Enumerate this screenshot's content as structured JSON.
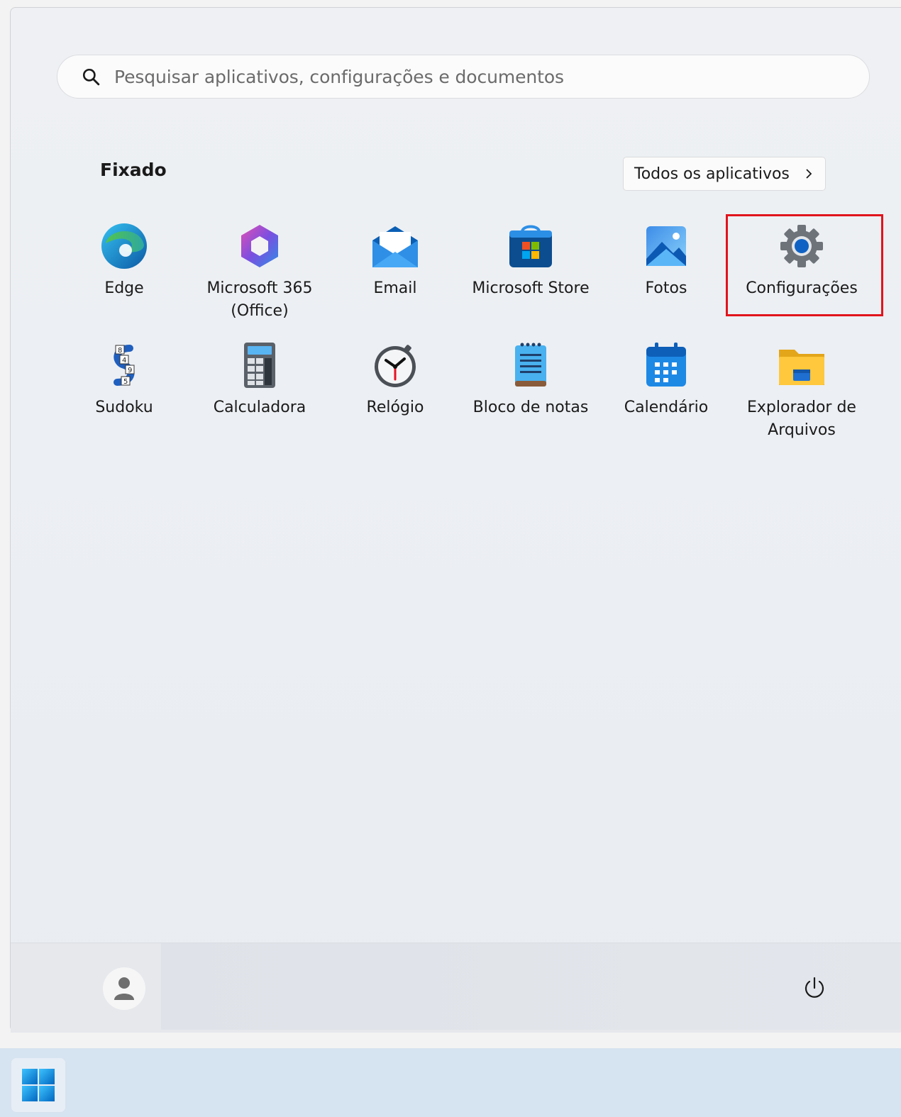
{
  "search": {
    "placeholder": "Pesquisar aplicativos, configurações e documentos",
    "icon": "search-icon"
  },
  "pinned": {
    "title": "Fixado",
    "all_apps_label": "Todos os aplicativos",
    "apps": [
      {
        "label": "Edge",
        "icon": "edge-icon"
      },
      {
        "label": "Microsoft 365\n(Office)",
        "icon": "microsoft-365-icon"
      },
      {
        "label": "Email",
        "icon": "mail-icon"
      },
      {
        "label": "Microsoft Store",
        "icon": "store-icon"
      },
      {
        "label": "Fotos",
        "icon": "photos-icon"
      },
      {
        "label": "Configurações",
        "icon": "gear-icon"
      },
      {
        "label": "Sudoku",
        "icon": "sudoku-icon"
      },
      {
        "label": "Calculadora",
        "icon": "calculator-icon"
      },
      {
        "label": "Relógio",
        "icon": "clock-icon"
      },
      {
        "label": "Bloco de notas",
        "icon": "notepad-icon"
      },
      {
        "label": "Calendário",
        "icon": "calendar-icon"
      },
      {
        "label": "Explorador de\nArquivos",
        "icon": "folder-icon"
      }
    ]
  },
  "footer": {
    "user_icon": "user-avatar-icon",
    "power_icon": "power-icon"
  },
  "taskbar": {
    "start_icon": "windows-logo-icon"
  },
  "colors": {
    "highlight": "#e1141c",
    "accent": "#0067c0"
  }
}
